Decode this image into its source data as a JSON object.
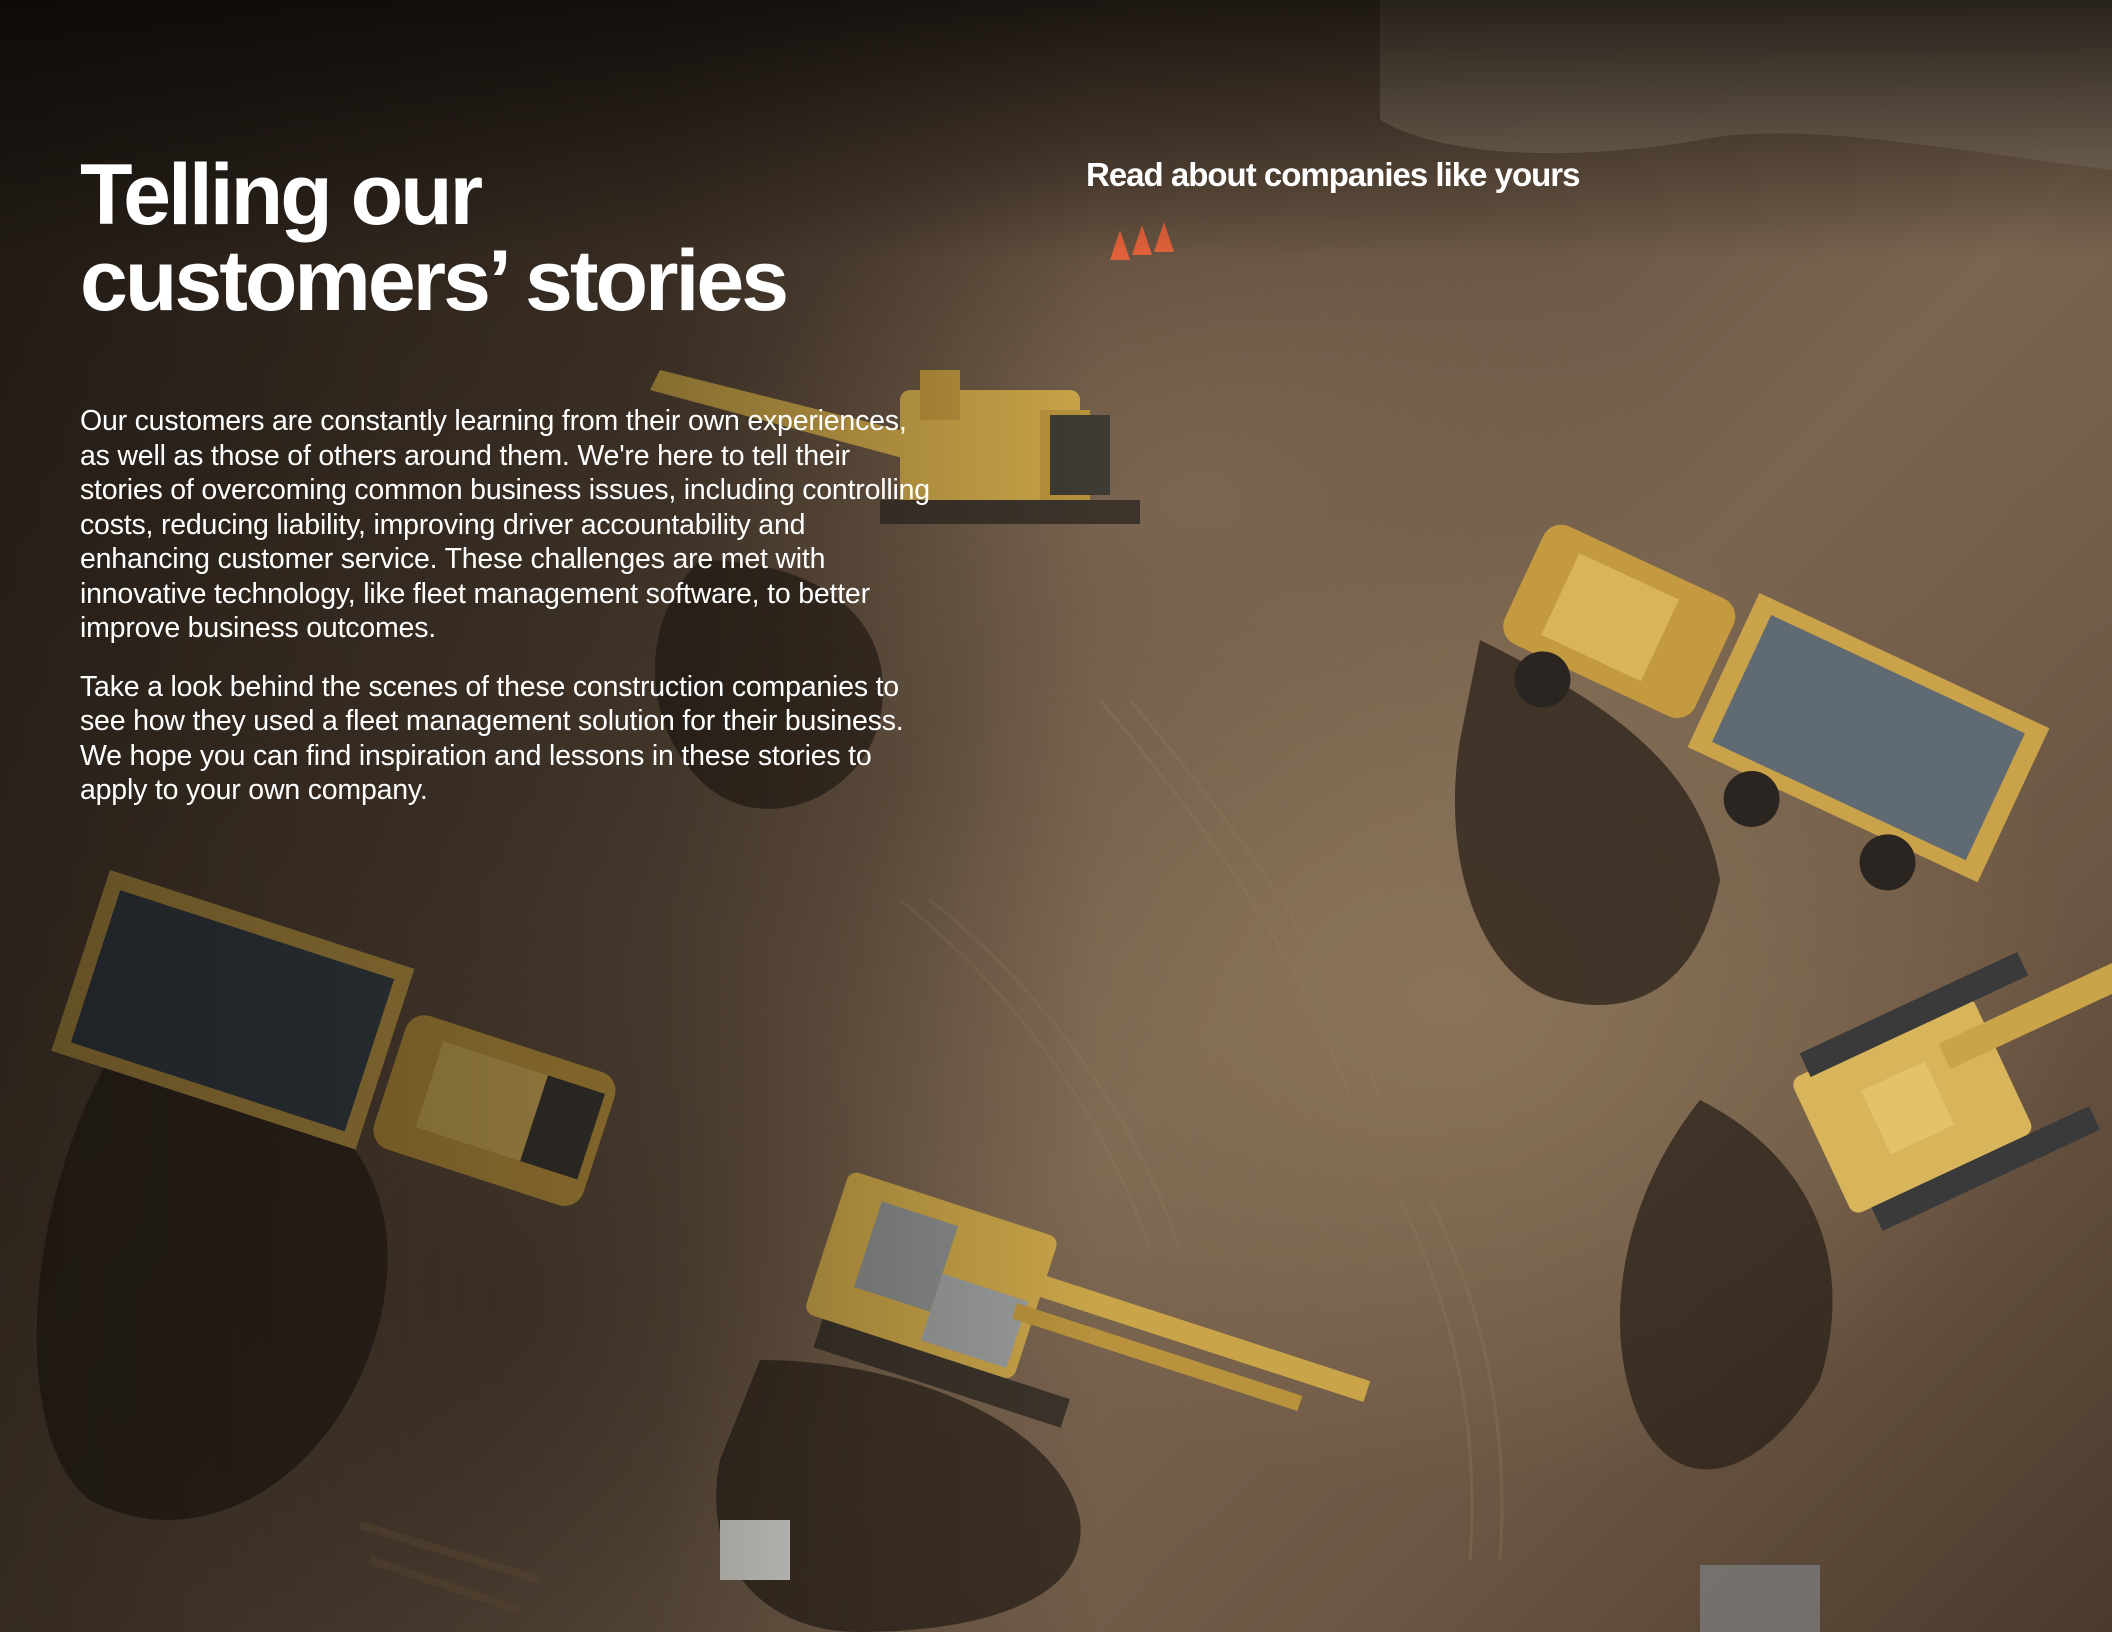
{
  "heading": {
    "line1": "Telling our",
    "line2": "customers’ stories"
  },
  "link": {
    "label": "Read about companies like yours"
  },
  "body": {
    "paragraph1": "Our customers are constantly learning from their own experiences, as well as those of others around them. We're here to tell their stories of overcoming common business issues, including controlling costs, reducing liability, improving driver accountability and enhancing customer service. These challenges are met with innovative technology, like fleet management software, to better improve business outcomes.",
    "paragraph2": "Take a look behind the scenes of these construction companies to see how they used a fleet management solution for their business. We hope you can find inspiration and lessons in these stories to apply to your own company."
  },
  "colors": {
    "machine_yellow": "#c9a448",
    "soil": "#7a6550",
    "text": "#ffffff"
  },
  "background_image": "aerial-construction-site-photo"
}
